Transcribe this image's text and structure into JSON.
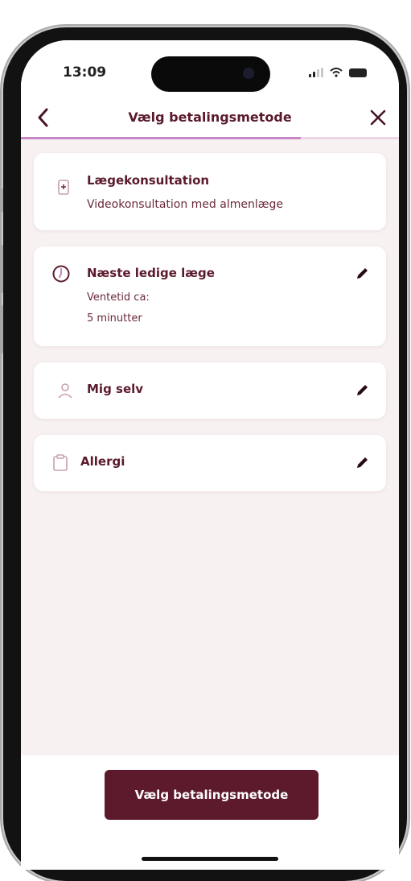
{
  "status": {
    "time": "13:09"
  },
  "nav": {
    "title": "Vælg betalingsmetode",
    "back_icon": "chevron-left-icon",
    "close_icon": "close-icon",
    "progress": 0.74
  },
  "cards": [
    {
      "icon": "medical-icon",
      "title": "Lægekonsultation",
      "subtitle": "Videokonsultation med almenlæge"
    },
    {
      "icon": "clock-icon",
      "title": "Næste ledige læge",
      "line1": "Ventetid ca:",
      "line2": "5 minutter",
      "edit_icon": "pencil-icon"
    },
    {
      "icon": "person-icon",
      "title": "Mig selv",
      "edit_icon": "pencil-icon"
    },
    {
      "icon": "clipboard-icon",
      "title": "Allergi",
      "edit_icon": "pencil-icon"
    }
  ],
  "cta": {
    "label": "Vælg betalingsmetode"
  },
  "colors": {
    "brand": "#5e1a2d",
    "accent": "#c786c6",
    "background": "#f7f1f1"
  }
}
